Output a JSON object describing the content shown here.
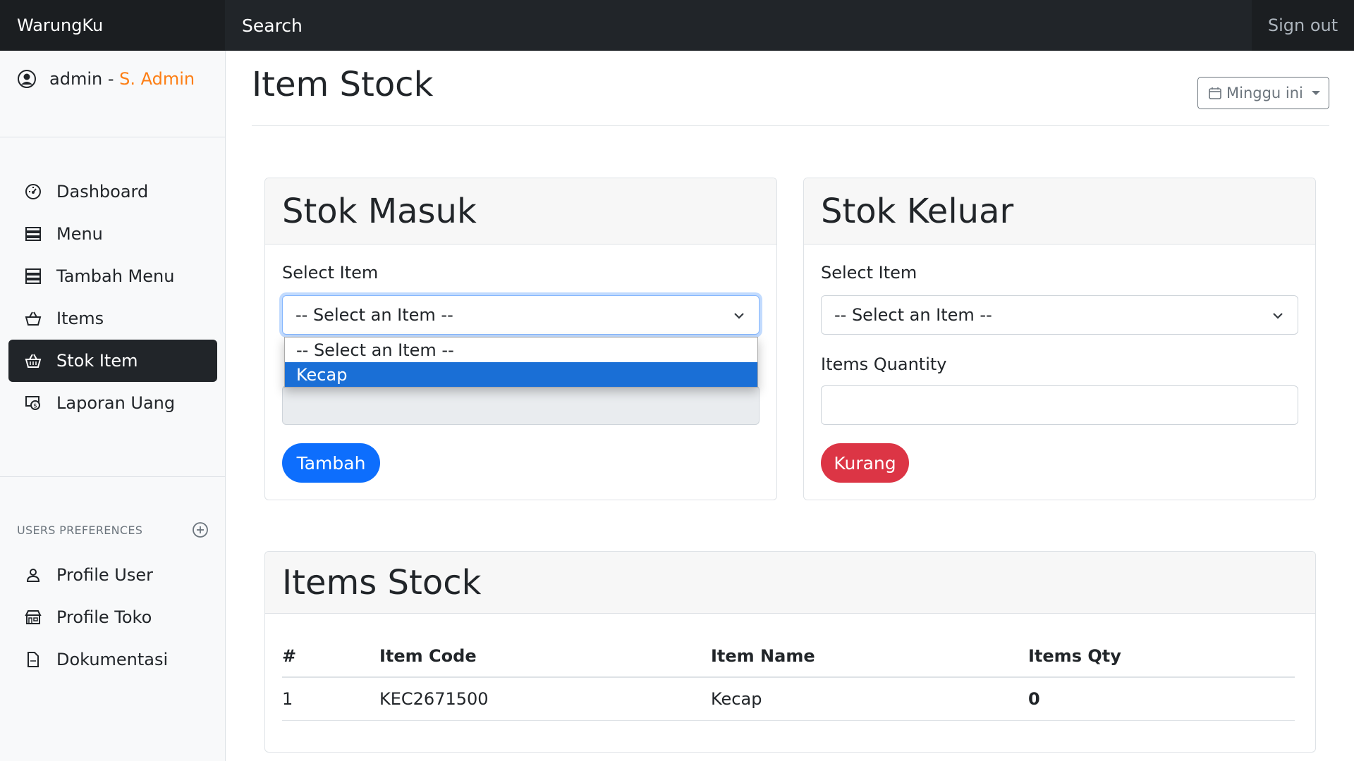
{
  "navbar": {
    "brand": "WarungKu",
    "search": "Search",
    "signout": "Sign out"
  },
  "sidebar": {
    "user": {
      "name": "admin",
      "separator": " - ",
      "role": "S. Admin",
      "role_color": "#fd7e14"
    },
    "items": [
      {
        "label": "Dashboard",
        "icon": "speedometer-icon",
        "active": false
      },
      {
        "label": "Menu",
        "icon": "menu-list-icon",
        "active": false
      },
      {
        "label": "Tambah Menu",
        "icon": "add-menu-icon",
        "active": false
      },
      {
        "label": "Items",
        "icon": "basket-icon",
        "active": false
      },
      {
        "label": "Stok Item",
        "icon": "basket-icon",
        "active": true
      },
      {
        "label": "Laporan Uang",
        "icon": "money-report-icon",
        "active": false
      }
    ],
    "preferences_heading": "USERS PREFERENCES",
    "preferences": [
      {
        "label": "Profile User",
        "icon": "person-icon"
      },
      {
        "label": "Profile Toko",
        "icon": "shop-icon"
      },
      {
        "label": "Dokumentasi",
        "icon": "document-icon"
      }
    ]
  },
  "main": {
    "title": "Item Stock",
    "period": "Minggu ini",
    "stok_masuk": {
      "title": "Stok Masuk",
      "select_label": "Select Item",
      "select_value": "-- Select an Item --",
      "dropdown_options": [
        "-- Select an Item --",
        "Kecap"
      ],
      "highlighted_option": "Kecap",
      "button": "Tambah"
    },
    "stok_keluar": {
      "title": "Stok Keluar",
      "select_label": "Select Item",
      "select_value": "-- Select an Item --",
      "qty_label": "Items Quantity",
      "button": "Kurang"
    },
    "items_stock": {
      "title": "Items Stock",
      "columns": [
        "#",
        "Item Code",
        "Item Name",
        "Items Qty"
      ],
      "rows": [
        {
          "no": "1",
          "code": "KEC2671500",
          "name": "Kecap",
          "qty": "0"
        }
      ]
    }
  },
  "colors": {
    "primary": "#0d6efd",
    "danger": "#dc3545",
    "dark": "#212529",
    "accent": "#fd7e14"
  }
}
